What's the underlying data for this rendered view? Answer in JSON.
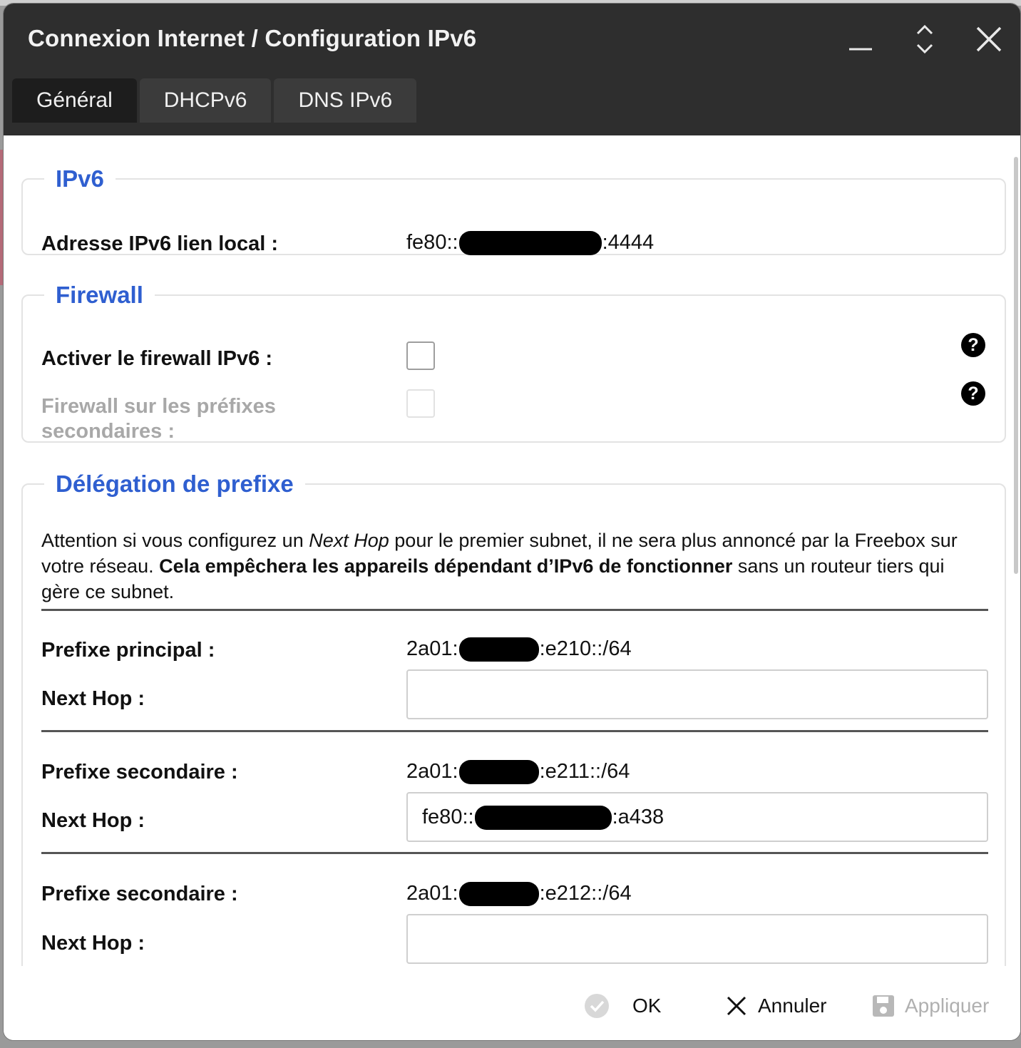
{
  "window": {
    "title": "Connexion Internet / Configuration IPv6",
    "controls": [
      "minimize-icon",
      "expand-icon",
      "close-icon"
    ]
  },
  "tabs": [
    {
      "label": "Général",
      "active": true
    },
    {
      "label": "DHCPv6",
      "active": false
    },
    {
      "label": "DNS IPv6",
      "active": false
    }
  ],
  "ipv6": {
    "legend": "IPv6",
    "link_local_label": "Adresse IPv6 lien local :",
    "link_local_prefix": "fe80::",
    "link_local_suffix": ":4444"
  },
  "firewall": {
    "legend": "Firewall",
    "enable_label": "Activer le firewall IPv6 :",
    "enable_checked": false,
    "secondary_label": "Firewall sur les préfixes secondaires :",
    "secondary_checked": false,
    "secondary_disabled": true,
    "help_glyph": "?"
  },
  "delegation": {
    "legend": "Délégation de prefixe",
    "notice_part1": "Attention si vous configurez un ",
    "notice_em": "Next Hop",
    "notice_part2": " pour le premier subnet, il ne sera plus annoncé par la Freebox sur votre réseau. ",
    "notice_bold": "Cela empêchera les appareils dépendant d’IPv6 de fonctionner",
    "notice_part3": " sans un routeur tiers qui gère ce subnet.",
    "next_hop_label": "Next Hop :",
    "prefixes": [
      {
        "label": "Prefixe principal :",
        "value_prefix": "2a01:",
        "value_suffix": ":e210::/64",
        "next_hop_prefix": "",
        "next_hop_suffix": ""
      },
      {
        "label": "Prefixe secondaire :",
        "value_prefix": "2a01:",
        "value_suffix": ":e211::/64",
        "next_hop_prefix": "fe80::",
        "next_hop_suffix": ":a438"
      },
      {
        "label": "Prefixe secondaire :",
        "value_prefix": "2a01:",
        "value_suffix": ":e212::/64",
        "next_hop_prefix": "",
        "next_hop_suffix": ""
      }
    ]
  },
  "footer": {
    "ok_label": "OK",
    "cancel_label": "Annuler",
    "apply_label": "Appliquer",
    "apply_disabled": true
  },
  "colors": {
    "titlebar": "#2e2e2e",
    "legend": "#2f5fd0",
    "active_tab": "#1d1d1d"
  }
}
